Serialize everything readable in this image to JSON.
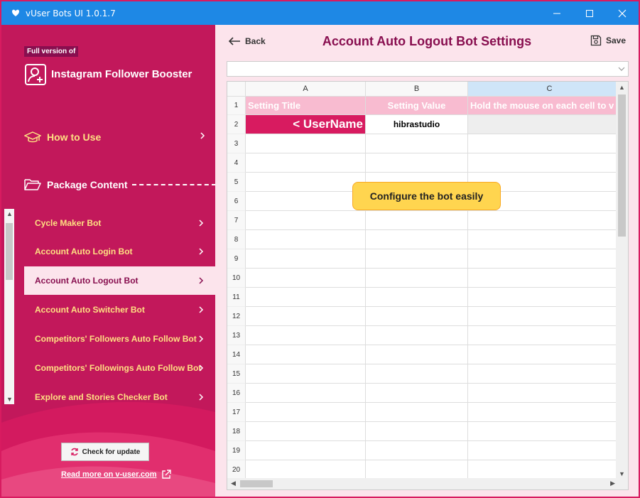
{
  "window": {
    "title": "vUser Bots UI 1.0.1.7"
  },
  "sidebar": {
    "badge": "Full version of",
    "app_name": "Instagram Follower Booster",
    "how_to_use": "How to Use",
    "package_content": "Package Content",
    "items": [
      {
        "label": "Cycle Maker Bot",
        "active": false
      },
      {
        "label": "Account Auto Login Bot",
        "active": false
      },
      {
        "label": "Account Auto Logout Bot",
        "active": true
      },
      {
        "label": "Account Auto Switcher Bot",
        "active": false
      },
      {
        "label": "Competitors' Followers Auto Follow Bot",
        "active": false
      },
      {
        "label": "Competitors' Followings Auto Follow Bot",
        "active": false
      },
      {
        "label": "Explore and Stories Checker Bot",
        "active": false
      }
    ],
    "update_button": "Check for update",
    "read_more": "Read more on v-user.com"
  },
  "main": {
    "back_label": "Back",
    "title": "Account Auto Logout Bot Settings",
    "save_label": "Save",
    "dropdown_value": "",
    "tooltip": "Configure the bot easily"
  },
  "grid": {
    "columns": [
      "A",
      "B",
      "C"
    ],
    "rows": [
      "1",
      "2",
      "3",
      "4",
      "5",
      "6",
      "7",
      "8",
      "9",
      "10",
      "11",
      "12",
      "13",
      "14",
      "15",
      "16",
      "17",
      "18",
      "19",
      "20"
    ],
    "header_row": [
      "Setting Title",
      "Setting Value",
      "Hold the mouse on each cell to v"
    ],
    "row2": [
      "< UserName",
      "hibrastudio",
      ""
    ]
  },
  "colors": {
    "sidebar_bg": "#c2185b",
    "accent": "#d81b60",
    "title_color": "#880e4f",
    "tooltip_bg": "#ffd54f",
    "titlebar": "#1e88e5"
  }
}
